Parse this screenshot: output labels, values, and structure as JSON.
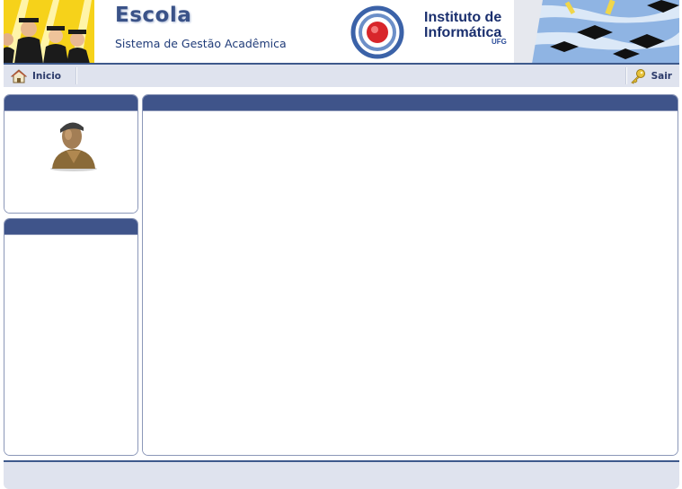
{
  "header": {
    "app_title": "Escola",
    "app_subtitle": "Sistema de Gestão Acadêmica",
    "institute_name_line1": "Instituto de",
    "institute_name_line2": "Informática",
    "institute_sub": "UFG"
  },
  "toolbar": {
    "home_label": "Inicio",
    "home_icon": "home-icon",
    "exit_label": "Sair",
    "exit_icon": "key-icon"
  },
  "panels": {
    "user_title": "",
    "menu_title": "",
    "main_title": ""
  },
  "colors": {
    "header_blue": "#3f548a",
    "toolbar_bg": "#dfe3ee",
    "title_blue": "#3a5288"
  }
}
